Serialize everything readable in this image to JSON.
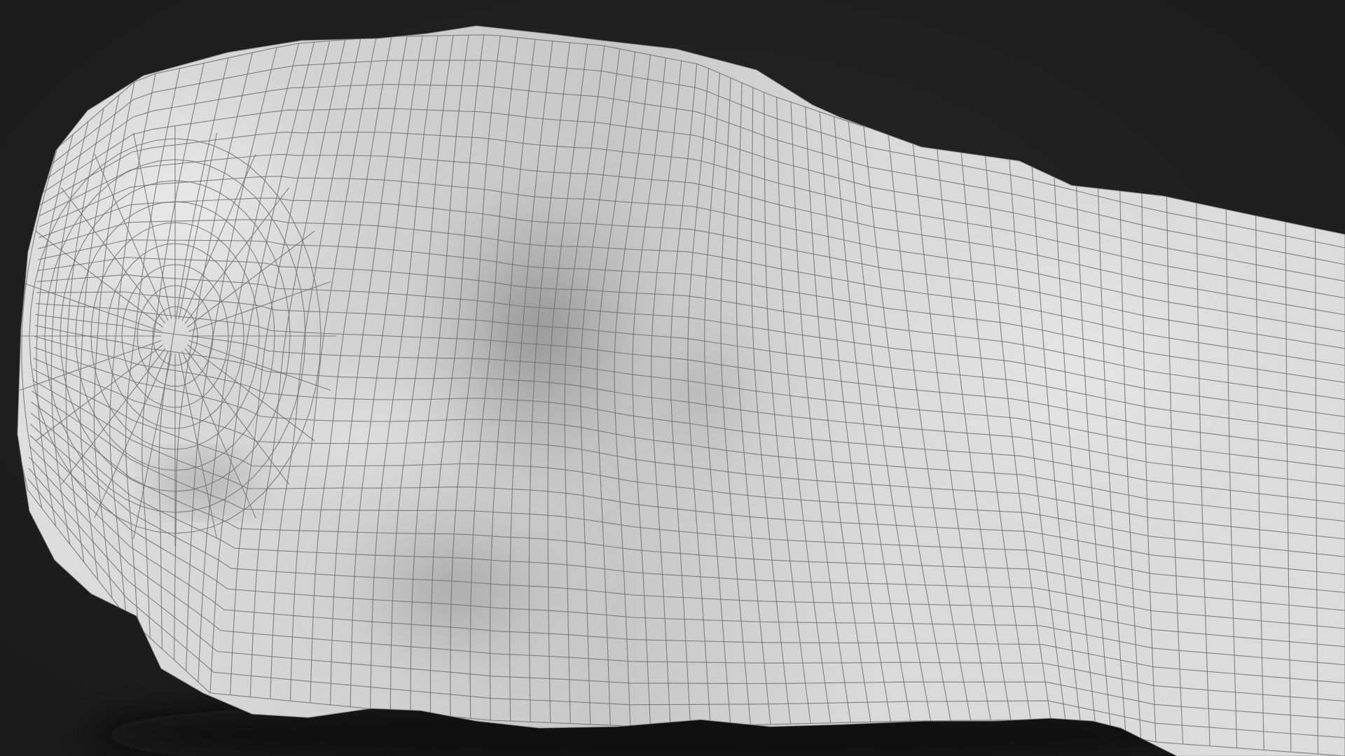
{
  "scene": {
    "subject_icon": "wireframe-mesh-icon",
    "background_color": "#1f1f1f",
    "shadow_color": "#151515",
    "surface_color": "#d4d4d4",
    "surface_shade_color": "#8e8e8e",
    "wire_color": "#6f6f6f"
  }
}
